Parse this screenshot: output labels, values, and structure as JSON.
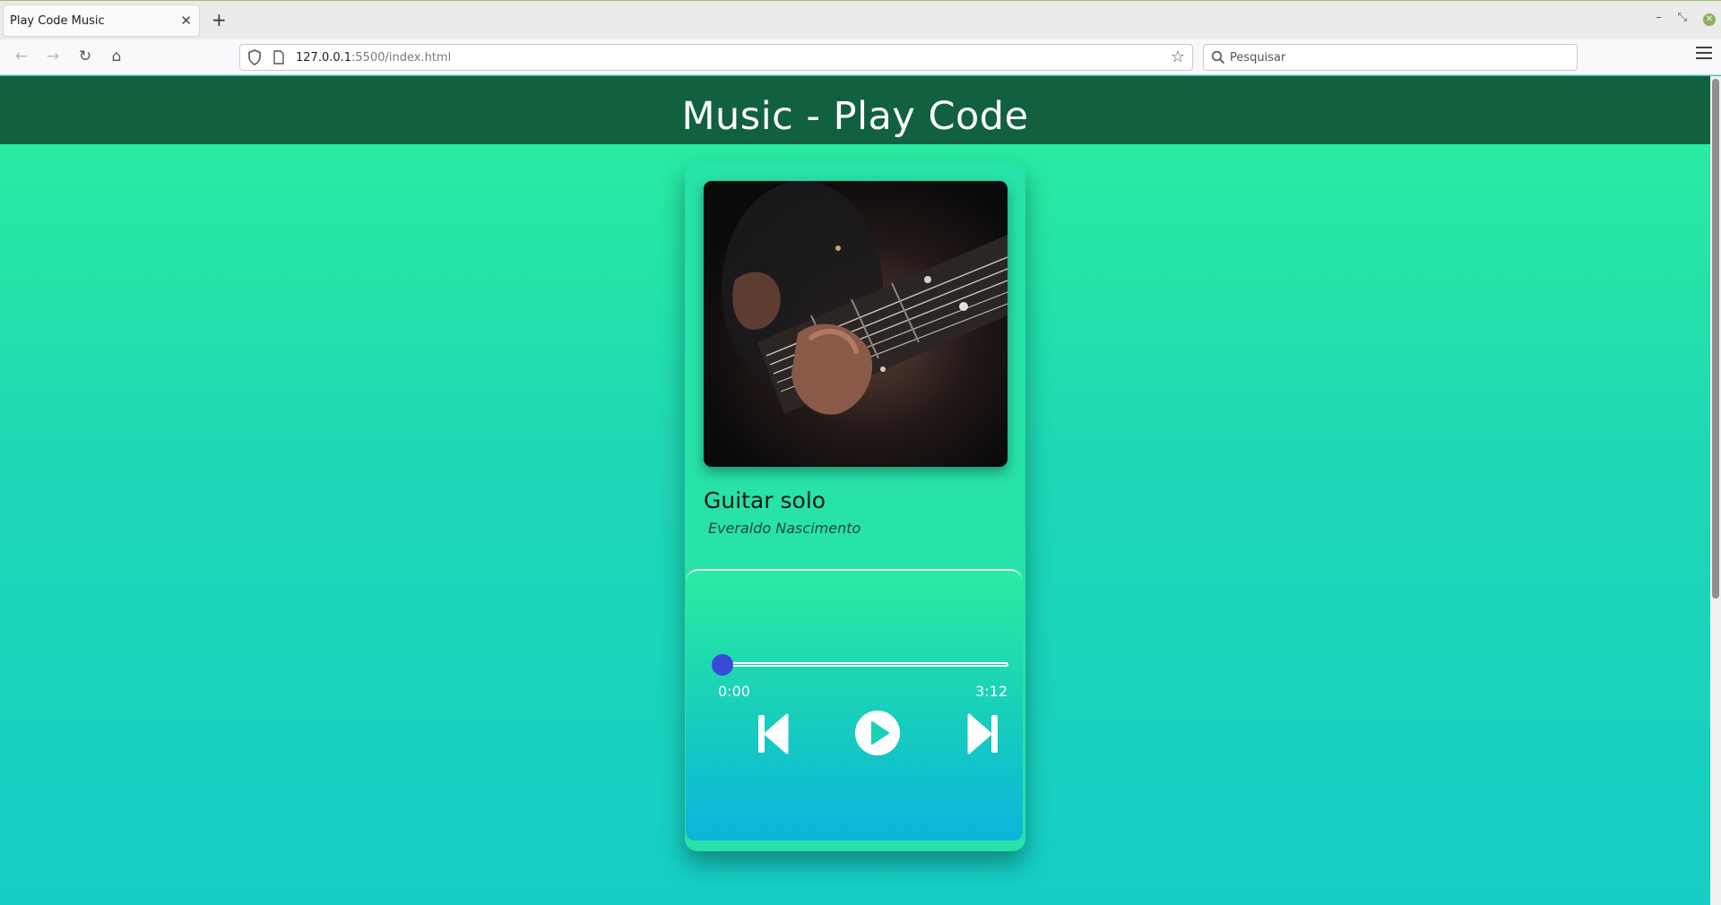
{
  "browser": {
    "tab_title": "Play Code Music",
    "url_host": "127.0.0.1",
    "url_path": ":5500/index.html",
    "search_placeholder": "Pesquisar"
  },
  "page": {
    "header_title": "Music - Play Code",
    "song": {
      "title": "Guitar solo",
      "artist": "Everaldo Nascimento",
      "cover_icon": "guitar-photo"
    },
    "player": {
      "current_time": "0:00",
      "duration": "3:12",
      "progress_fraction": 0,
      "buttons": [
        "previous-icon",
        "play-icon",
        "next-icon"
      ]
    }
  },
  "colors": {
    "header_bg": "#11613f",
    "accent_knob": "#3a4ad8",
    "card_bg": "#27e2a9"
  }
}
